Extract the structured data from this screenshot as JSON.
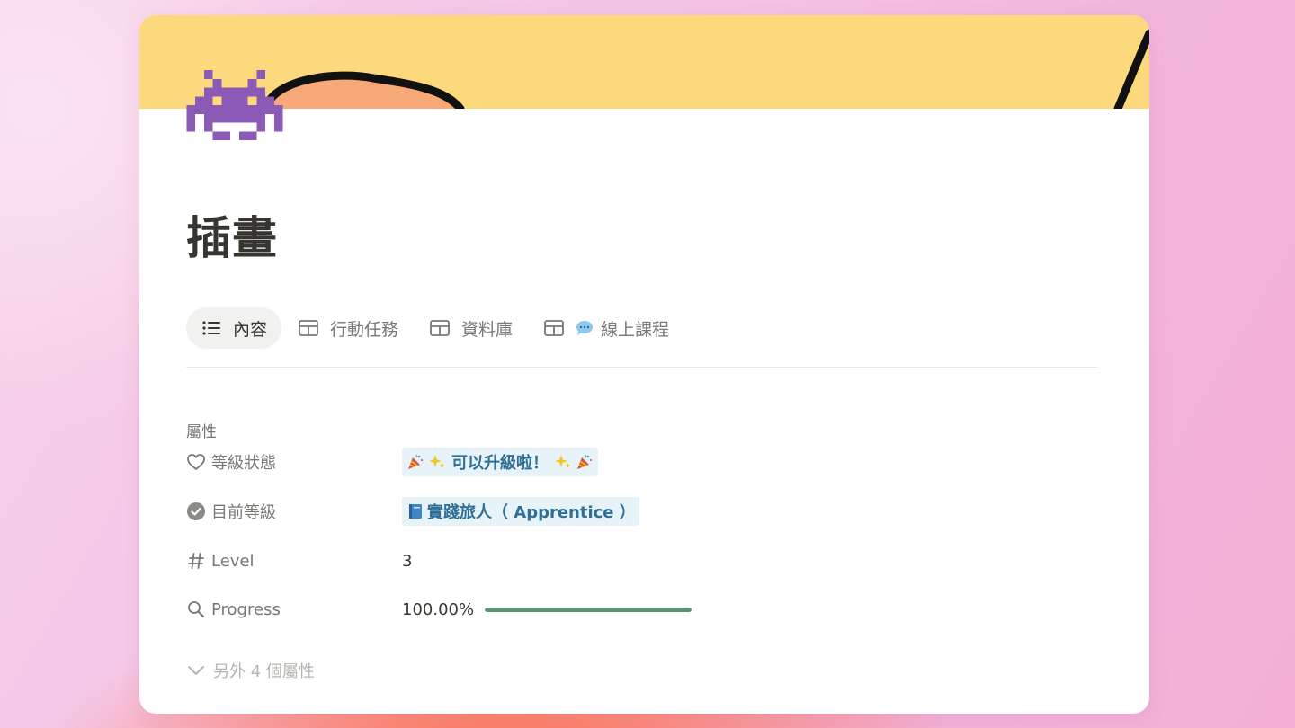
{
  "page": {
    "title": "插畫"
  },
  "cover": {
    "background_color": "#fdd97d",
    "illustration": "cartoon-face-outline"
  },
  "icon": {
    "name": "space-invader-icon",
    "color": "#8b5ab6"
  },
  "tabs": [
    {
      "label": "內容",
      "icon": "list-icon",
      "active": true
    },
    {
      "label": "行動任務",
      "icon": "table-icon",
      "active": false
    },
    {
      "label": "資料庫",
      "icon": "table-icon",
      "active": false
    },
    {
      "label": "線上課程",
      "icon": "table-icon",
      "extra_icon": "speech-bubble-icon",
      "active": false
    }
  ],
  "properties": {
    "heading": "屬性",
    "items": [
      {
        "label": "等級狀態",
        "icon": "heart-icon",
        "value": "可以升級啦！",
        "value_type": "tag",
        "tag_color": "#e7f3f8",
        "tag_text_color": "#2f6f96"
      },
      {
        "label": "目前等級",
        "icon": "check-circle-icon",
        "value": "實踐旅人（ Apprentice ）",
        "value_type": "tag",
        "tag_color": "#e7f3f8",
        "tag_text_color": "#2f6f96"
      },
      {
        "label": "Level",
        "icon": "hash-icon",
        "value": "3",
        "value_type": "number"
      },
      {
        "label": "Progress",
        "icon": "search-icon",
        "value": "100.00%",
        "value_type": "progress",
        "progress_fraction": 1.0,
        "progress_color": "#5c9478"
      }
    ],
    "more_label": "另外 4 個屬性"
  }
}
